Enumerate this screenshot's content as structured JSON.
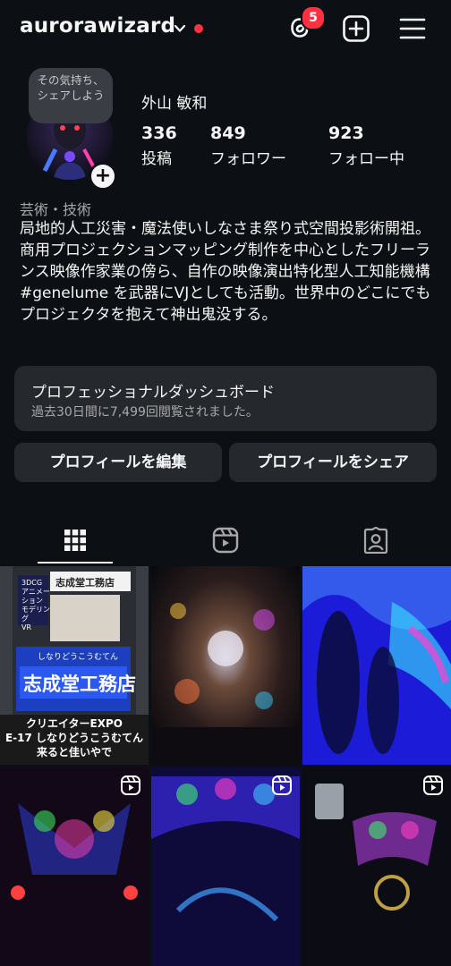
{
  "header": {
    "username": "aurorawizard",
    "threads_badge_count": "5",
    "colors": {
      "notification_dot": "#ff3040",
      "background": "#0c1014"
    }
  },
  "profile": {
    "note": "その気持ち、シェアしよう",
    "full_name": "外山 敏和",
    "stats": [
      {
        "value": "336",
        "label": "投稿"
      },
      {
        "value": "849",
        "label": "フォロワー"
      },
      {
        "value": "923",
        "label": "フォロー中"
      }
    ],
    "category": "芸術・技術",
    "bio_lines": [
      "局地的人工災害・魔法使いしなさま祭り式空間投影術開祖。",
      "商用プロジェクションマッピング制作を中心としたフリーランス映像作家業の傍ら、自作の映像演出特化型人工知能機構 #genelume を武器にVJとしても活動。世界中のどこにでもプロジェクタを抱えて神出鬼没する。"
    ]
  },
  "dashboard": {
    "title": "プロフェッショナルダッシュボード",
    "subtitle": "過去30日間に7,499回閲覧されました。"
  },
  "actions": {
    "edit_profile": "プロフィールを編集",
    "share_profile": "プロフィールをシェア"
  },
  "tabs": [
    {
      "icon": "grid-icon",
      "active": true
    },
    {
      "icon": "reels-icon",
      "active": false
    },
    {
      "icon": "tagged-icon",
      "active": false
    }
  ],
  "grid": {
    "tile1": {
      "sign_top": "志成堂工務店",
      "poster_lines": [
        "3DCG",
        "アニメーション",
        "モデリング",
        "VR"
      ],
      "screen_small": "しなりどうこうむてん",
      "screen_big": "志成堂工務店",
      "caption_lines": [
        "クリエイターEXPO",
        "E-17 しなりどうこうむてん",
        "来ると佳いやで"
      ]
    }
  }
}
